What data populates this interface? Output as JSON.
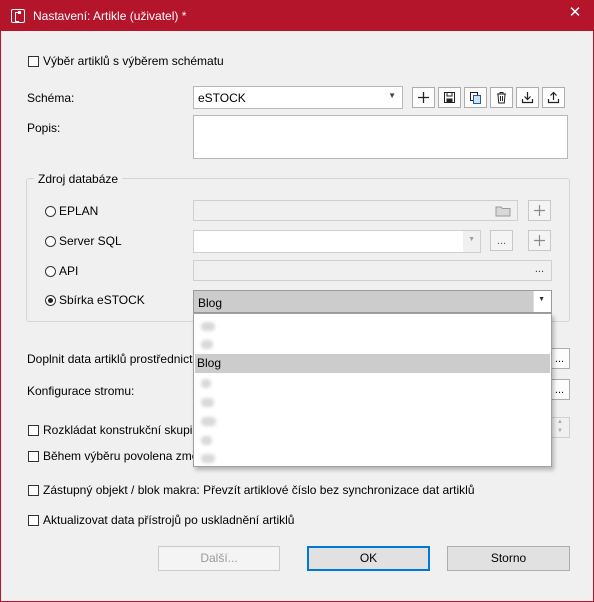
{
  "window": {
    "title": "Nastavení: Artikle (uživatel) *",
    "close_glyph": "✕",
    "accent": "#b5152b"
  },
  "schema_select_checkbox": {
    "label": "Výběr artiklů s výběrem schématu",
    "checked": false
  },
  "schema": {
    "label": "Schéma:",
    "value": "eSTOCK",
    "tools": [
      "plus-icon",
      "save-icon",
      "copy-icon",
      "delete-icon",
      "import-icon",
      "export-icon"
    ]
  },
  "description": {
    "label": "Popis:",
    "value": ""
  },
  "db_source": {
    "title": "Zdroj databáze",
    "options": [
      {
        "label": "EPLAN",
        "selected": false
      },
      {
        "label": "Server SQL",
        "selected": false
      },
      {
        "label": "API",
        "selected": false
      },
      {
        "label": "Sbírka eSTOCK",
        "selected": true
      }
    ],
    "ellipsis": "...",
    "collection_value": "Blog",
    "dropdown_items": [
      "",
      "",
      "Blog",
      "",
      "",
      "",
      "",
      ""
    ],
    "dropdown_selected_index": 2
  },
  "supplement": {
    "label": "Doplnit data artiklů prostřednict",
    "button": "..."
  },
  "tree_config": {
    "label": "Konfigurace stromu:",
    "button": "..."
  },
  "checkboxes": [
    {
      "label": "Rozkládat konstrukční skupin",
      "checked": false
    },
    {
      "label": "Během výběru povolena změ",
      "checked": false
    },
    {
      "label": "Zástupný objekt / blok makra: Převzít artiklové číslo bez synchronizace dat artiklů",
      "checked": false
    },
    {
      "label": "Aktualizovat data přístrojů po uskladnění artiklů",
      "checked": false
    }
  ],
  "buttons": {
    "next": "Další...",
    "ok": "OK",
    "cancel": "Storno"
  }
}
